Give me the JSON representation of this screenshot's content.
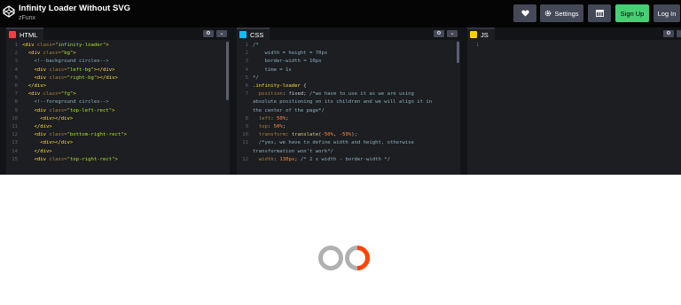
{
  "header": {
    "title": "Infinity Loader Without SVG",
    "author": "zFunx",
    "buttons": {
      "settings": "Settings",
      "signup": "Sign Up",
      "login": "Log In"
    },
    "icons": [
      "codepen-logo-icon",
      "heart-icon",
      "gear-icon",
      "layout-icon"
    ]
  },
  "editors": {
    "html": {
      "label": "HTML",
      "badge_color": "#ff3c41",
      "lines": [
        "<div class=\"infinity-loader\">",
        "  <div class=\"bg\">",
        "    <!--background circles-->",
        "    <div class=\"left-bg\"></div>",
        "    <div class=\"right-bg\"></div>",
        "  </div>",
        "  <div class=\"fg\">",
        "    <!--foreground circles-->",
        "    <div class=\"top-left-rect\">",
        "      <div></div>",
        "    </div>",
        "    <div class=\"bottom-right-rect\">",
        "      <div></div>",
        "    </div>",
        "    <div class=\"top-right-rect\">"
      ]
    },
    "css": {
      "label": "CSS",
      "badge_color": "#0ebeff",
      "lines": [
        "/*",
        "    width = height = 70px",
        "    border-width = 10px",
        "    time = 1s",
        "*/",
        ".infinity-loader {",
        "  position: fixed; /*we have to use it as we are using",
        "absolute positioning on its children and we will align it in",
        "the center of the page*/",
        "  left: 50%;",
        "  top: 50%;",
        "  transform: translate(-50%, -50%);",
        "  /*yes, we have to define width and height, otherwise",
        "transformation won't work*/",
        "  width: 130px; /* 2 x width - border-width */"
      ]
    },
    "js": {
      "label": "JS",
      "badge_color": "#fcd000",
      "lines": [
        ""
      ]
    }
  },
  "preview": {
    "loader_colors": {
      "background_ring": "#b0b0b0",
      "foreground_arc": "#ff4500"
    }
  }
}
